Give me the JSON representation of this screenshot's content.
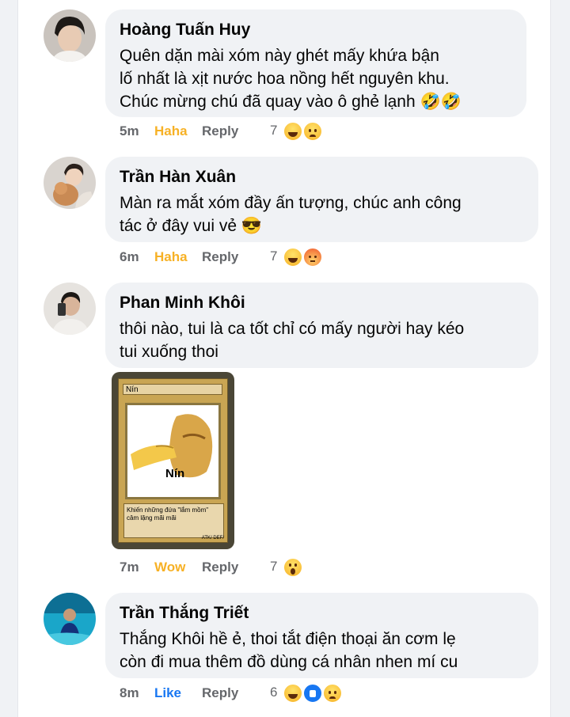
{
  "comments": [
    {
      "author": "Hoàng Tuấn Huy",
      "lines": [
        "Quên dặn mài xóm này ghét mấy khứa bận",
        "lố nhất là xịt nước hoa nồng hết nguyên khu.",
        "Chúc mừng chú đã quay vào ô ghẻ lạnh 🤣🤣"
      ],
      "time": "5m",
      "reaction_label": "Haha",
      "reply_label": "Reply",
      "reaction_count": "7"
    },
    {
      "author": "Trần Hàn Xuân",
      "lines": [
        "Màn ra mắt xóm đầy ấn tượng, chúc anh công",
        "tác ở đây vui vẻ 😎"
      ],
      "time": "6m",
      "reaction_label": "Haha",
      "reply_label": "Reply",
      "reaction_count": "7"
    },
    {
      "author": "Phan Minh Khôi",
      "lines": [
        "thôi nào, tui là ca tốt chỉ có mấy người hay kéo",
        "tui xuống thoi"
      ],
      "time": "7m",
      "reaction_label": "Wow",
      "reply_label": "Reply",
      "reaction_count": "7"
    },
    {
      "author": "Trần Thắng Triết",
      "lines": [
        "Thắng Khôi hề ẻ, thoi tắt điện thoại ăn cơm lẹ",
        "còn đi mua thêm đồ dùng cá nhân nhen mí cu"
      ],
      "time": "8m",
      "reaction_label": "Like",
      "reply_label": "Reply",
      "reaction_count": "6"
    }
  ],
  "meme": {
    "card_title": "Nín",
    "art_caption": "Nín",
    "description": "Khiến những đứa \"lắm mồm\" câm lặng mãi mãi",
    "stats": "ATK/      DEF/"
  },
  "colors": {
    "haha": "#f7b125",
    "like": "#1877f2",
    "bubble": "#f0f2f5"
  }
}
